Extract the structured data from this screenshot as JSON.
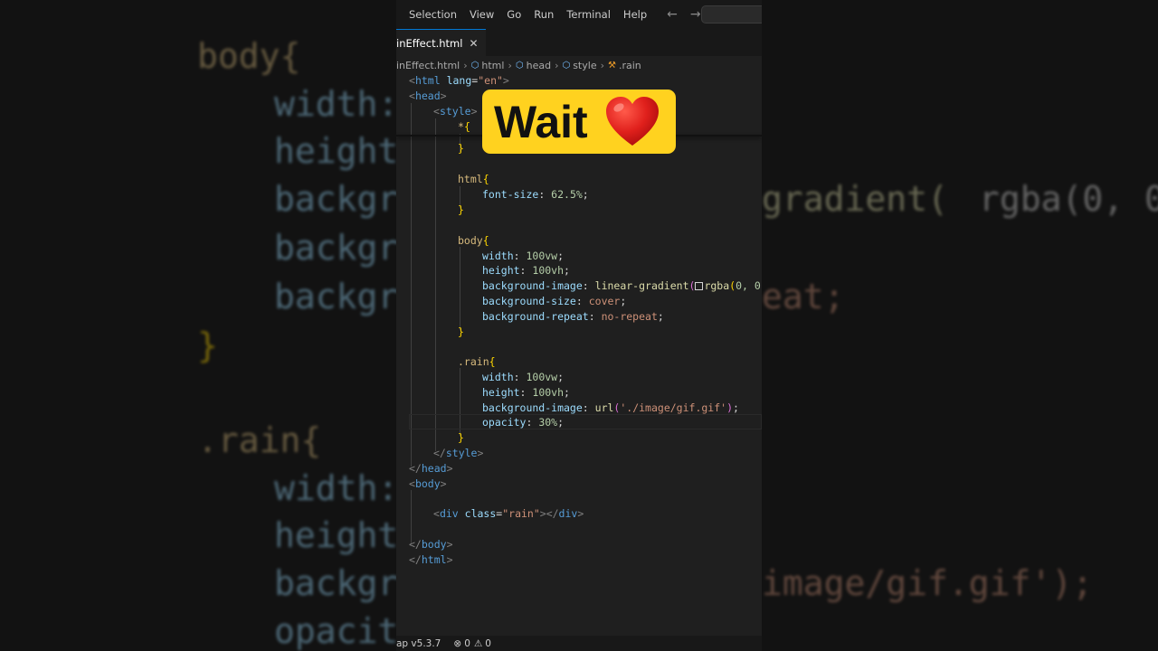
{
  "menu": {
    "items": [
      "Selection",
      "View",
      "Go",
      "Run",
      "Terminal",
      "Help"
    ],
    "back_arrow": "←",
    "forward_arrow": "→"
  },
  "tab": {
    "label": "inEffect.html",
    "close": "✕"
  },
  "breadcrumb": {
    "file": "inEffect.html",
    "items": [
      "html",
      "head",
      "style",
      ".rain"
    ]
  },
  "code": {
    "l1_tag": "html",
    "l1_attr": "lang",
    "l1_val": "\"en\"",
    "l2_tag": "head",
    "l3_tag": "style",
    "l4_sel": "*",
    "html_sel": "html",
    "fontsize_prop": "font-size",
    "fontsize_val": "62.5%",
    "body_sel": "body",
    "width_prop": "width",
    "width_val": "100vw",
    "height_prop": "height",
    "height_val": "100vh",
    "bgimg_prop": "background-image",
    "bgimg_fn": "linear-gradient",
    "bgimg_fn2": "rgba",
    "bgimg_args": "0, 0",
    "bgsize_prop": "background-size",
    "bgsize_val": "cover",
    "bgrepeat_prop": "background-repeat",
    "bgrepeat_val": "no-repeat",
    "rain_sel": ".rain",
    "url_fn": "url",
    "url_val": "'./image/gif.gif'",
    "opacity_prop": "opacity",
    "opacity_val": "30%",
    "style_close": "style",
    "head_close": "head",
    "body_tag": "body",
    "div_tag": "div",
    "div_attr": "class",
    "div_val": "\"rain\"",
    "body_close": "body",
    "html_close": "html"
  },
  "status": {
    "version": "ap v5.3.7",
    "errors_icon": "⊗",
    "errors": "0",
    "warnings_icon": "⚠",
    "warnings": "0"
  },
  "overlay": {
    "text": "Wait",
    "heart_icon": "heart"
  },
  "background": {
    "l1": "body{",
    "l2": "width:",
    "l3": "height",
    "l4": "backgro",
    "l4b": "gradient(",
    "l4c": "rgba(0, 0",
    "l5": "backgro",
    "l5b": "eat;",
    "l6": "backgro",
    "l7": "}",
    "l8": ".rain{",
    "l9": "width:",
    "l10": "height",
    "l11": "backgro",
    "l11b": "image/gif.gif');",
    "l12": "opacity"
  },
  "colors": {
    "overlay_bg": "#ffd21f",
    "heart": "#e0201c",
    "editor_bg": "#1f1f1f"
  }
}
